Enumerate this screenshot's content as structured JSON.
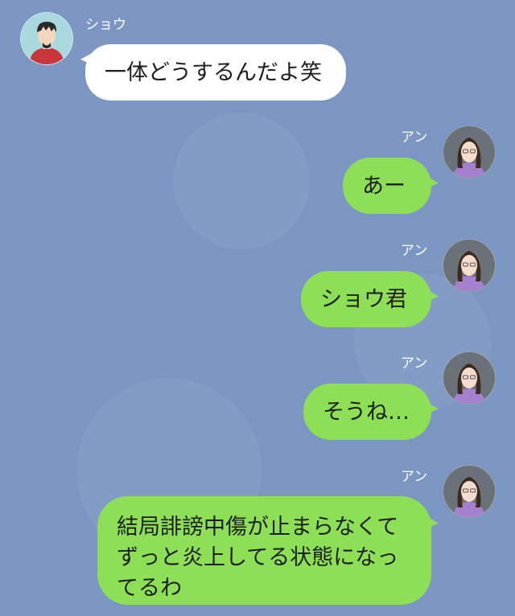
{
  "colors": {
    "background": "#7b96c3",
    "incoming_bubble": "#ffffff",
    "outgoing_bubble": "#8de055"
  },
  "messages": [
    {
      "sender": "ショウ",
      "direction": "incoming",
      "avatar": "male-avatar-icon",
      "text": "一体どうするんだよ笑"
    },
    {
      "sender": "アン",
      "direction": "outgoing",
      "avatar": "female-avatar-icon",
      "text": "あー"
    },
    {
      "sender": "アン",
      "direction": "outgoing",
      "avatar": "female-avatar-icon",
      "text": "ショウ君"
    },
    {
      "sender": "アン",
      "direction": "outgoing",
      "avatar": "female-avatar-icon",
      "text": "そうね…"
    },
    {
      "sender": "アン",
      "direction": "outgoing",
      "avatar": "female-avatar-icon",
      "lines": [
        "結局誹謗中傷が止まらなくて",
        "ずっと炎上してる状態になっ",
        "てるわ"
      ]
    }
  ]
}
